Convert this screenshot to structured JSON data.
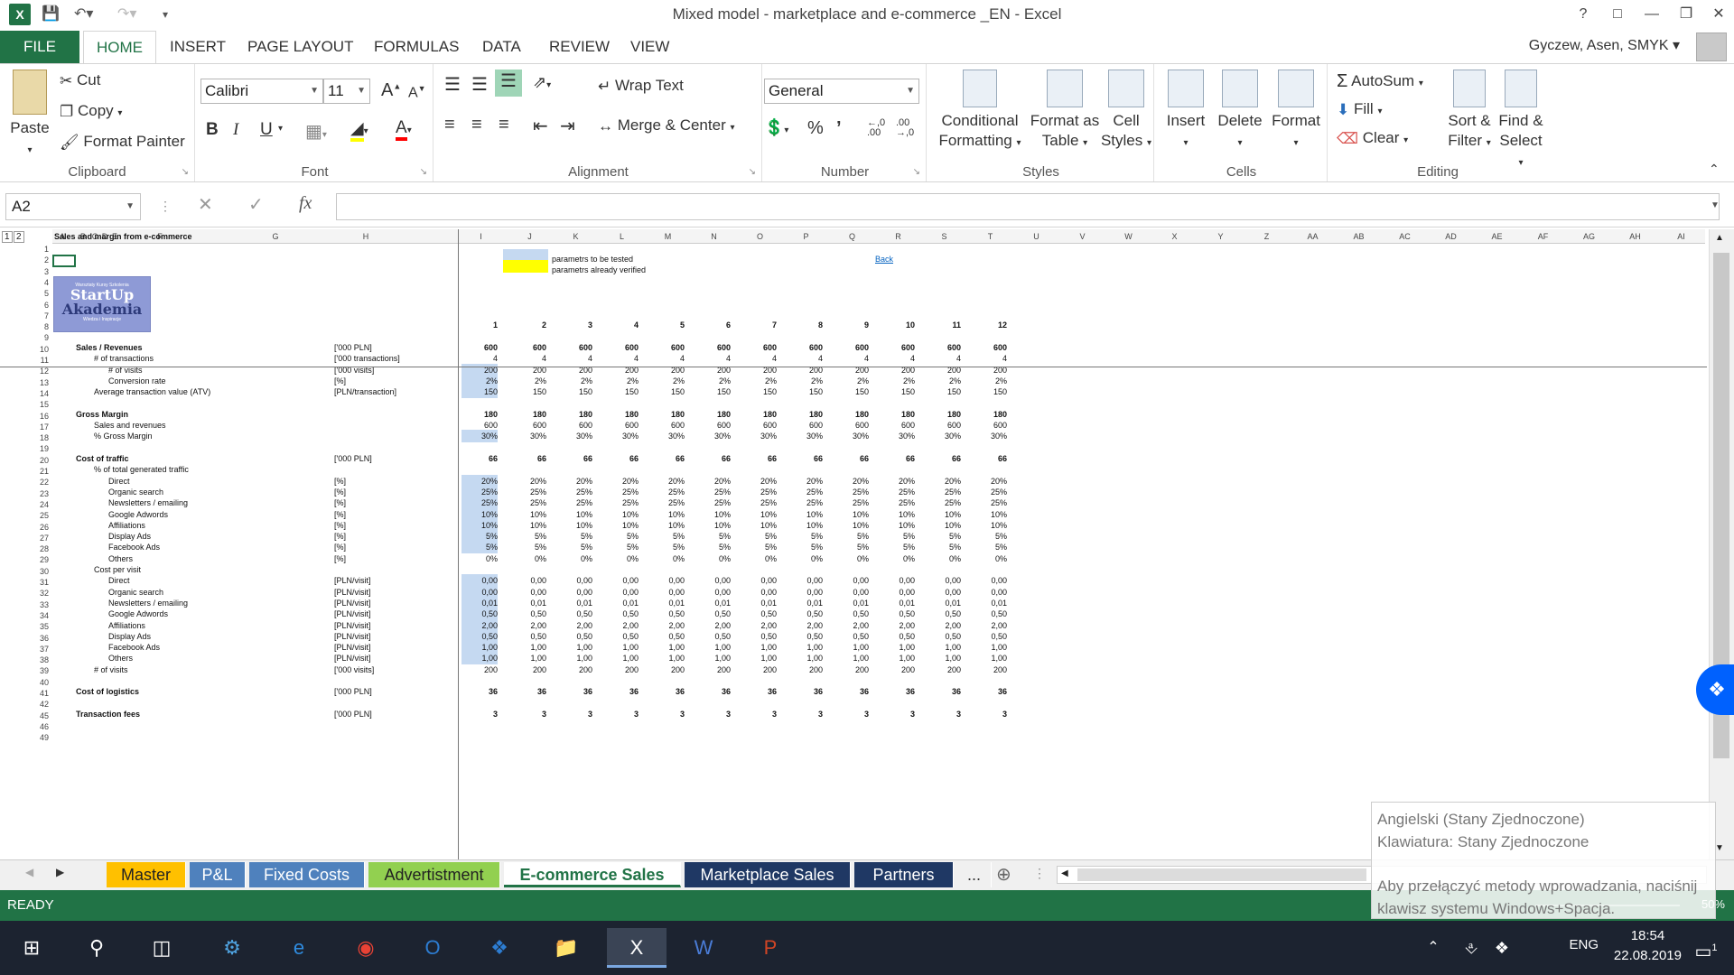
{
  "window": {
    "title": "Mixed model - marketplace and e-commerce _EN - Excel"
  },
  "ribbon_tabs": [
    "FILE",
    "HOME",
    "INSERT",
    "PAGE LAYOUT",
    "FORMULAS",
    "DATA",
    "REVIEW",
    "VIEW"
  ],
  "user": "Gyczew, Asen, SMYK",
  "clipboard": {
    "paste": "Paste",
    "cut": "Cut",
    "copy": "Copy",
    "format_painter": "Format Painter",
    "label": "Clipboard"
  },
  "font": {
    "name": "Calibri",
    "size": "11",
    "bold": "B",
    "italic": "I",
    "underline": "U",
    "label": "Font"
  },
  "alignment": {
    "wrap": "Wrap Text",
    "merge": "Merge & Center",
    "label": "Alignment"
  },
  "number": {
    "format": "General",
    "percent": "%",
    "comma": "’",
    "label": "Number",
    "inc": ".00",
    "dec": ",0"
  },
  "styles": {
    "conditional": "Conditional",
    "conditional2": "Formatting",
    "format_table": "Format as",
    "format_table2": "Table",
    "cell_styles": "Cell",
    "cell_styles2": "Styles",
    "label": "Styles"
  },
  "cells": {
    "insert": "Insert",
    "delete": "Delete",
    "format": "Format",
    "label": "Cells"
  },
  "editing": {
    "autosum": "AutoSum",
    "fill": "Fill",
    "clear": "Clear",
    "sort": "Sort &",
    "sort2": "Filter",
    "find": "Find &",
    "find2": "Select",
    "label": "Editing"
  },
  "formula_bar": {
    "name_box": "A2",
    "fx": "fx",
    "value": ""
  },
  "col_headers": [
    "A",
    "B",
    "C",
    "D",
    "E",
    "F",
    "G",
    "H",
    "I",
    "J",
    "K",
    "L",
    "M",
    "N",
    "O",
    "P",
    "Q",
    "R",
    "S",
    "T",
    "U",
    "V",
    "W",
    "X",
    "Y",
    "Z",
    "AA",
    "AB",
    "AC",
    "AD",
    "AE",
    "AF",
    "AG",
    "AH",
    "AI"
  ],
  "outline_levels": [
    "1",
    "2"
  ],
  "sheet": {
    "title": "Sales and margin from e-commerce",
    "legend_tested": "parametrs to be tested",
    "legend_verified": "parametrs already verified",
    "back_link": "Back",
    "logo_top": "Warsztaty Kursy Szkolenia",
    "logo_line1": "StartUp",
    "logo_line2": "Akademia",
    "logo_bottom": "Wiedza i Inspiracje",
    "months": [
      "1",
      "2",
      "3",
      "4",
      "5",
      "6",
      "7",
      "8",
      "9",
      "10",
      "11",
      "12"
    ],
    "rows": [
      {
        "r": "11",
        "label": "Sales / Revenues",
        "indent": 0,
        "bold": true,
        "unit": "['000 PLN]",
        "first": "600",
        "vals": "600"
      },
      {
        "r": "12",
        "label": "# of transactions",
        "indent": 1,
        "unit": "['000 transactions]",
        "first": "4",
        "vals": "4"
      },
      {
        "r": "13",
        "label": "# of visits",
        "indent": 2,
        "unit": "['000 visits]",
        "first": "200",
        "vals": "200",
        "hl": "blue"
      },
      {
        "r": "14",
        "label": "Conversion rate",
        "indent": 2,
        "unit": "[%]",
        "first": "2%",
        "vals": "2%",
        "hl": "blue"
      },
      {
        "r": "15",
        "label": "Average transaction value (ATV)",
        "indent": 1,
        "unit": "[PLN/transaction]",
        "first": "150",
        "vals": "150",
        "hl": "blue"
      },
      {
        "r": "17",
        "label": "Gross Margin",
        "indent": 0,
        "bold": true,
        "unit": "",
        "first": "180",
        "vals": "180"
      },
      {
        "r": "18",
        "label": "Sales and revenues",
        "indent": 1,
        "unit": "",
        "first": "600",
        "vals": "600"
      },
      {
        "r": "19",
        "label": "% Gross Margin",
        "indent": 1,
        "unit": "",
        "first": "30%",
        "vals": "30%",
        "hl": "blue"
      },
      {
        "r": "21",
        "label": "Cost of traffic",
        "indent": 0,
        "bold": true,
        "unit": "['000 PLN]",
        "first": "66",
        "vals": "66"
      },
      {
        "r": "22",
        "label": "% of total generated traffic",
        "indent": 1,
        "unit": "",
        "first": "",
        "vals": ""
      },
      {
        "r": "23",
        "label": "Direct",
        "indent": 2,
        "unit": "[%]",
        "first": "20%",
        "vals": "20%",
        "hl": "blue"
      },
      {
        "r": "24",
        "label": "Organic search",
        "indent": 2,
        "unit": "[%]",
        "first": "25%",
        "vals": "25%",
        "hl": "blue"
      },
      {
        "r": "25",
        "label": "Newsletters / emailing",
        "indent": 2,
        "unit": "[%]",
        "first": "25%",
        "vals": "25%",
        "hl": "blue"
      },
      {
        "r": "26",
        "label": "Google Adwords",
        "indent": 2,
        "unit": "[%]",
        "first": "10%",
        "vals": "10%",
        "hl": "blue"
      },
      {
        "r": "27",
        "label": "Affiliations",
        "indent": 2,
        "unit": "[%]",
        "first": "10%",
        "vals": "10%",
        "hl": "blue"
      },
      {
        "r": "28",
        "label": "Display Ads",
        "indent": 2,
        "unit": "[%]",
        "first": "5%",
        "vals": "5%",
        "hl": "blue"
      },
      {
        "r": "29",
        "label": "Facebook Ads",
        "indent": 2,
        "unit": "[%]",
        "first": "5%",
        "vals": "5%",
        "hl": "blue"
      },
      {
        "r": "30",
        "label": "Others",
        "indent": 2,
        "unit": "[%]",
        "first": "0%",
        "vals": "0%"
      },
      {
        "r": "31",
        "label": "Cost per visit",
        "indent": 1,
        "unit": "",
        "first": "",
        "vals": ""
      },
      {
        "r": "32",
        "label": "Direct",
        "indent": 2,
        "unit": "[PLN/visit]",
        "first": "0,00",
        "vals": "0,00",
        "hl": "blue"
      },
      {
        "r": "33",
        "label": "Organic search",
        "indent": 2,
        "unit": "[PLN/visit]",
        "first": "0,00",
        "vals": "0,00",
        "hl": "blue"
      },
      {
        "r": "34",
        "label": "Newsletters / emailing",
        "indent": 2,
        "unit": "[PLN/visit]",
        "first": "0,01",
        "vals": "0,01",
        "hl": "blue"
      },
      {
        "r": "35",
        "label": "Google Adwords",
        "indent": 2,
        "unit": "[PLN/visit]",
        "first": "0,50",
        "vals": "0,50",
        "hl": "blue"
      },
      {
        "r": "36",
        "label": "Affiliations",
        "indent": 2,
        "unit": "[PLN/visit]",
        "first": "2,00",
        "vals": "2,00",
        "hl": "blue"
      },
      {
        "r": "37",
        "label": "Display Ads",
        "indent": 2,
        "unit": "[PLN/visit]",
        "first": "0,50",
        "vals": "0,50",
        "hl": "blue"
      },
      {
        "r": "38",
        "label": "Facebook Ads",
        "indent": 2,
        "unit": "[PLN/visit]",
        "first": "1,00",
        "vals": "1,00",
        "hl": "blue"
      },
      {
        "r": "39",
        "label": "Others",
        "indent": 2,
        "unit": "[PLN/visit]",
        "first": "1,00",
        "vals": "1,00",
        "hl": "blue"
      },
      {
        "r": "40",
        "label": "# of visits",
        "indent": 1,
        "unit": "['000 visits]",
        "first": "200",
        "vals": "200"
      },
      {
        "r": "42",
        "label": "Cost of logistics",
        "indent": 0,
        "bold": true,
        "unit": "['000 PLN]",
        "first": "36",
        "vals": "36"
      },
      {
        "r": "46",
        "label": "Transaction fees",
        "indent": 0,
        "bold": true,
        "unit": "['000 PLN]",
        "first": "3",
        "vals": "3"
      }
    ]
  },
  "sheet_tabs": [
    {
      "name": "Master",
      "bg": "#ffc000",
      "fg": "#222"
    },
    {
      "name": "P&L",
      "bg": "#4f81bd",
      "fg": "#fff"
    },
    {
      "name": "Fixed Costs",
      "bg": "#4f81bd",
      "fg": "#fff"
    },
    {
      "name": "Advertistment",
      "bg": "#92d050",
      "fg": "#222"
    },
    {
      "name": "E-commerce Sales",
      "bg": "#ffffff",
      "fg": "#217346"
    },
    {
      "name": "Marketplace Sales",
      "bg": "#1f3864",
      "fg": "#fff"
    },
    {
      "name": "Partners",
      "bg": "#1f3864",
      "fg": "#fff"
    },
    {
      "name": "...",
      "bg": "#f0f0f0",
      "fg": "#333"
    }
  ],
  "status": {
    "ready": "READY",
    "zoom": "50%"
  },
  "ime": {
    "line1": "Angielski (Stany Zjednoczone)",
    "line2": "Klawiatura: Stany Zjednoczone",
    "line3": "Aby przełączyć metody wprowadzania, naciśnij",
    "line4": "klawisz systemu Windows+Spacja."
  },
  "taskbar": {
    "lang": "ENG",
    "time": "18:54",
    "date": "22.08.2019",
    "notif": "1"
  }
}
